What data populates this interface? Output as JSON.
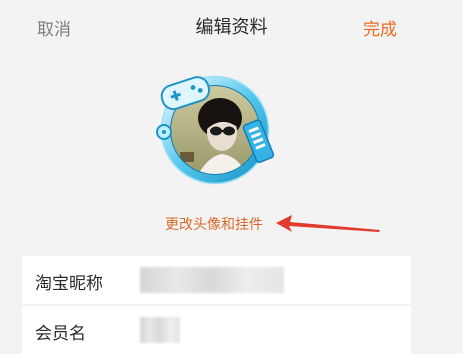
{
  "header": {
    "cancel_label": "取消",
    "title": "编辑资料",
    "done_label": "完成"
  },
  "avatar": {
    "change_label": "更改头像和挂件"
  },
  "profile": {
    "rows": [
      {
        "label": "淘宝昵称",
        "value": ""
      },
      {
        "label": "会员名",
        "value": ""
      }
    ]
  },
  "colors": {
    "accent": "#ee6a1e",
    "change_link": "#d96a2b",
    "arrow": "#e23b2e",
    "background": "#f3f3f3"
  },
  "icons": {
    "arrow": "left-arrow-annotation",
    "avatar_frame": "game-controller-frame-pendant"
  }
}
